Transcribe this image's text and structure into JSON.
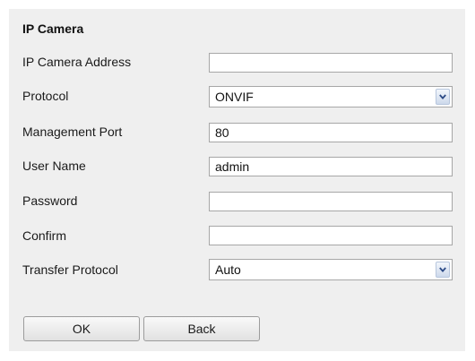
{
  "section": {
    "title": "IP Camera"
  },
  "fields": {
    "ip_address": {
      "label": "IP Camera Address",
      "value": ""
    },
    "protocol": {
      "label": "Protocol",
      "value": "ONVIF"
    },
    "management_port": {
      "label": "Management Port",
      "value": "80"
    },
    "user_name": {
      "label": "User Name",
      "value": "admin"
    },
    "password": {
      "label": "Password",
      "value": ""
    },
    "confirm": {
      "label": "Confirm",
      "value": ""
    },
    "transfer_protocol": {
      "label": "Transfer Protocol",
      "value": "Auto"
    }
  },
  "buttons": {
    "ok": "OK",
    "back": "Back"
  },
  "icons": {
    "dropdown": "chevron-down-icon"
  },
  "colors": {
    "panel_background": "#efefef",
    "field_border": "#a7a7a7",
    "dropdown_chevron": "#2b4a86"
  }
}
